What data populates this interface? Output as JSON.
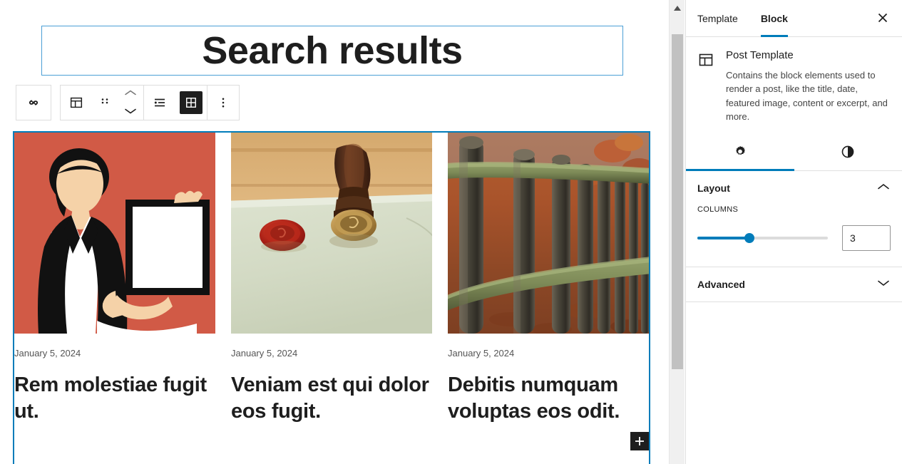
{
  "editor": {
    "heading": {
      "text": "Search results"
    },
    "toolbar": {
      "parent_block_label": "Query Loop",
      "parent_block_icon": "loop-icon",
      "block_type_label": "Post Template",
      "block_type_icon": "post-template-icon",
      "drag_label": "Drag",
      "drag_icon": "drag-handle-icon",
      "move_up_label": "Move up",
      "move_up_icon": "chevron-up-icon",
      "move_down_label": "Move down",
      "move_down_icon": "chevron-down-icon",
      "list_view_label": "List view",
      "list_view_icon": "list-view-icon",
      "grid_view_label": "Grid view",
      "grid_view_icon": "grid-view-icon",
      "grid_view_active": true,
      "options_label": "Options",
      "options_icon": "more-vertical-icon"
    },
    "appender": {
      "label": "Add block",
      "icon": "plus-icon"
    },
    "posts": [
      {
        "date": "January 5, 2024",
        "title": "Rem molestiae fugit ut.",
        "image_name": "businesswoman-holding-frame-illustration"
      },
      {
        "date": "January 5, 2024",
        "title": "Veniam est qui dolor eos fugit.",
        "image_name": "wax-seal-stamp-on-parchment-photo"
      },
      {
        "date": "January 5, 2024",
        "title": "Debitis numquam voluptas eos odit.",
        "image_name": "wooden-fence-autumn-leaves-photo"
      }
    ]
  },
  "scrollbar": {
    "up_arrow_icon": "scroll-up-arrow-icon",
    "thumb_name": "scroll-thumb"
  },
  "sidebar": {
    "tabs": [
      {
        "label": "Template",
        "active": false
      },
      {
        "label": "Block",
        "active": true
      }
    ],
    "close_label": "Close settings",
    "close_icon": "close-icon",
    "block_card": {
      "icon": "post-template-icon",
      "title": "Post Template",
      "description": "Contains the block elements used to render a post, like the title, date, featured image, content or excerpt, and more."
    },
    "icon_tabs": [
      {
        "name": "settings-tab",
        "icon": "gear-icon",
        "active": true
      },
      {
        "name": "styles-tab",
        "icon": "contrast-icon",
        "active": false
      }
    ],
    "panels": [
      {
        "title": "Layout",
        "expanded": true,
        "toggle_icon": "chevron-up-icon",
        "field_label": "COLUMNS",
        "value": "3",
        "slider_percent": 40
      },
      {
        "title": "Advanced",
        "expanded": false,
        "toggle_icon": "chevron-down-icon"
      }
    ]
  },
  "colors": {
    "accent": "#007cba",
    "selection_border": "#007cba",
    "heading_border": "#4b9fd5",
    "dark": "#1e1e1e",
    "scroll_thumb": "#c1c1c1",
    "image1_background": "#d15a46"
  }
}
